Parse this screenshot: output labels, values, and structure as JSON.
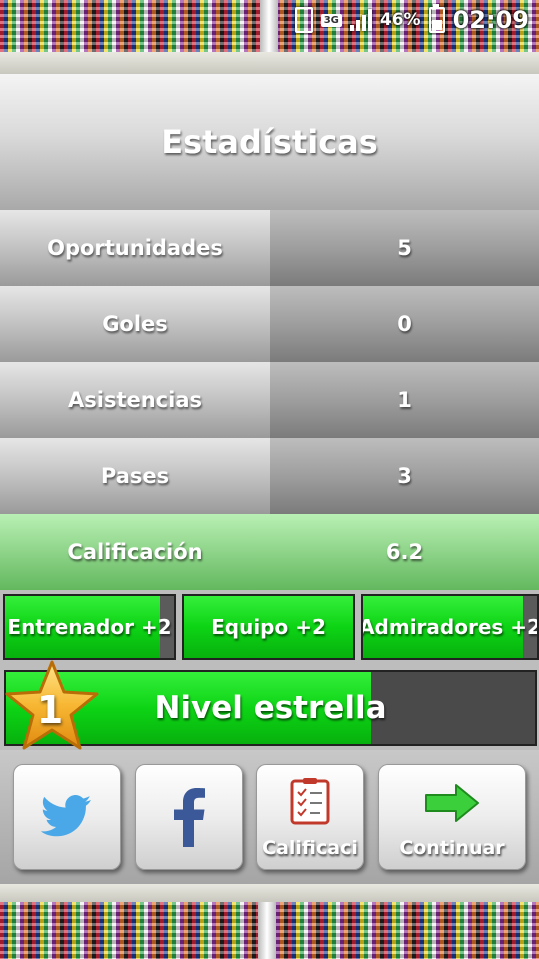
{
  "status_bar": {
    "network": "3G",
    "battery_percent": "46%",
    "time": "02:09"
  },
  "stats": {
    "title": "Estadísticas",
    "rows": [
      {
        "label": "Oportunidades",
        "value": "5"
      },
      {
        "label": "Goles",
        "value": "0"
      },
      {
        "label": "Asistencias",
        "value": "1"
      },
      {
        "label": "Pases",
        "value": "3"
      }
    ],
    "rating": {
      "label": "Calificación",
      "value": "6.2"
    }
  },
  "bonuses": [
    {
      "label": "Entrenador +2",
      "fill_fraction": 0.92
    },
    {
      "label": "Equipo +2",
      "fill_fraction": 1.0
    },
    {
      "label": "Admiradores +2",
      "fill_fraction": 0.92
    }
  ],
  "star_level": {
    "level": "1",
    "label": "Nivel estrella",
    "fill_fraction": 0.69
  },
  "actions": {
    "twitter_icon": "twitter-bird-icon",
    "facebook_icon": "facebook-f-icon",
    "rating_caption": "Calificaci",
    "continue_caption": "Continuar"
  },
  "colors": {
    "green_fill": "#0dd415",
    "rating_row": "#8ed489",
    "twitter": "#4aa8e8",
    "facebook": "#3b5998"
  }
}
